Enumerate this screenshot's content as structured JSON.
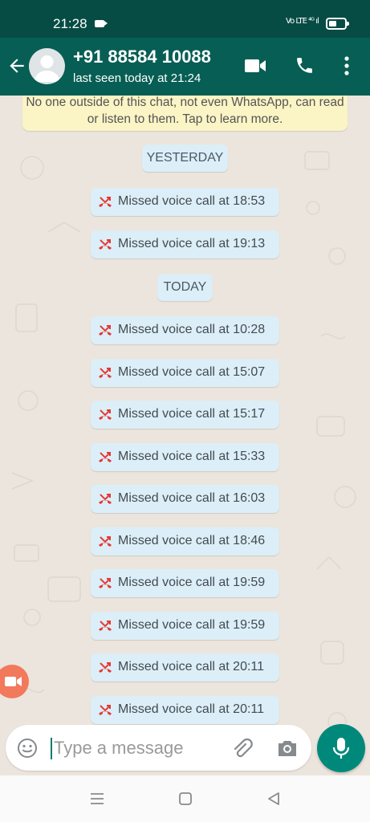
{
  "status_bar": {
    "time": "21:28",
    "network": "Vo LTE ⁴ᴳ ıl",
    "battery_level_percent": 50
  },
  "header": {
    "contact_name": "+91 88584 10088",
    "last_seen": "last seen today at 21:24",
    "colors": {
      "header": "#075e54",
      "status": "#064c44"
    }
  },
  "chat": {
    "encryption_note": "No one outside of this chat, not even WhatsApp, can read or listen to them. Tap to learn more.",
    "date_chips": [
      "YESTERDAY",
      "TODAY"
    ],
    "missed_calls": [
      "Missed voice call at 18:53",
      "Missed voice call at 19:13",
      "Missed voice call at 10:28",
      "Missed voice call at 15:07",
      "Missed voice call at 15:17",
      "Missed voice call at 15:33",
      "Missed voice call at 16:03",
      "Missed voice call at 18:46",
      "Missed voice call at 19:59",
      "Missed voice call at 19:59",
      "Missed voice call at 20:11",
      "Missed voice call at 20:11"
    ],
    "missed_call_icon": "missed-call-icon",
    "missed_call_color": "#e53935"
  },
  "input": {
    "placeholder": "Type a message",
    "value": ""
  },
  "icons": {
    "back": "back-arrow-icon",
    "video": "video-call-icon",
    "voice": "voice-call-icon",
    "menu": "more-options-icon",
    "emoji": "emoji-icon",
    "attach": "attach-icon",
    "camera": "camera-icon",
    "mic": "microphone-icon"
  },
  "accent_color": "#00897b"
}
